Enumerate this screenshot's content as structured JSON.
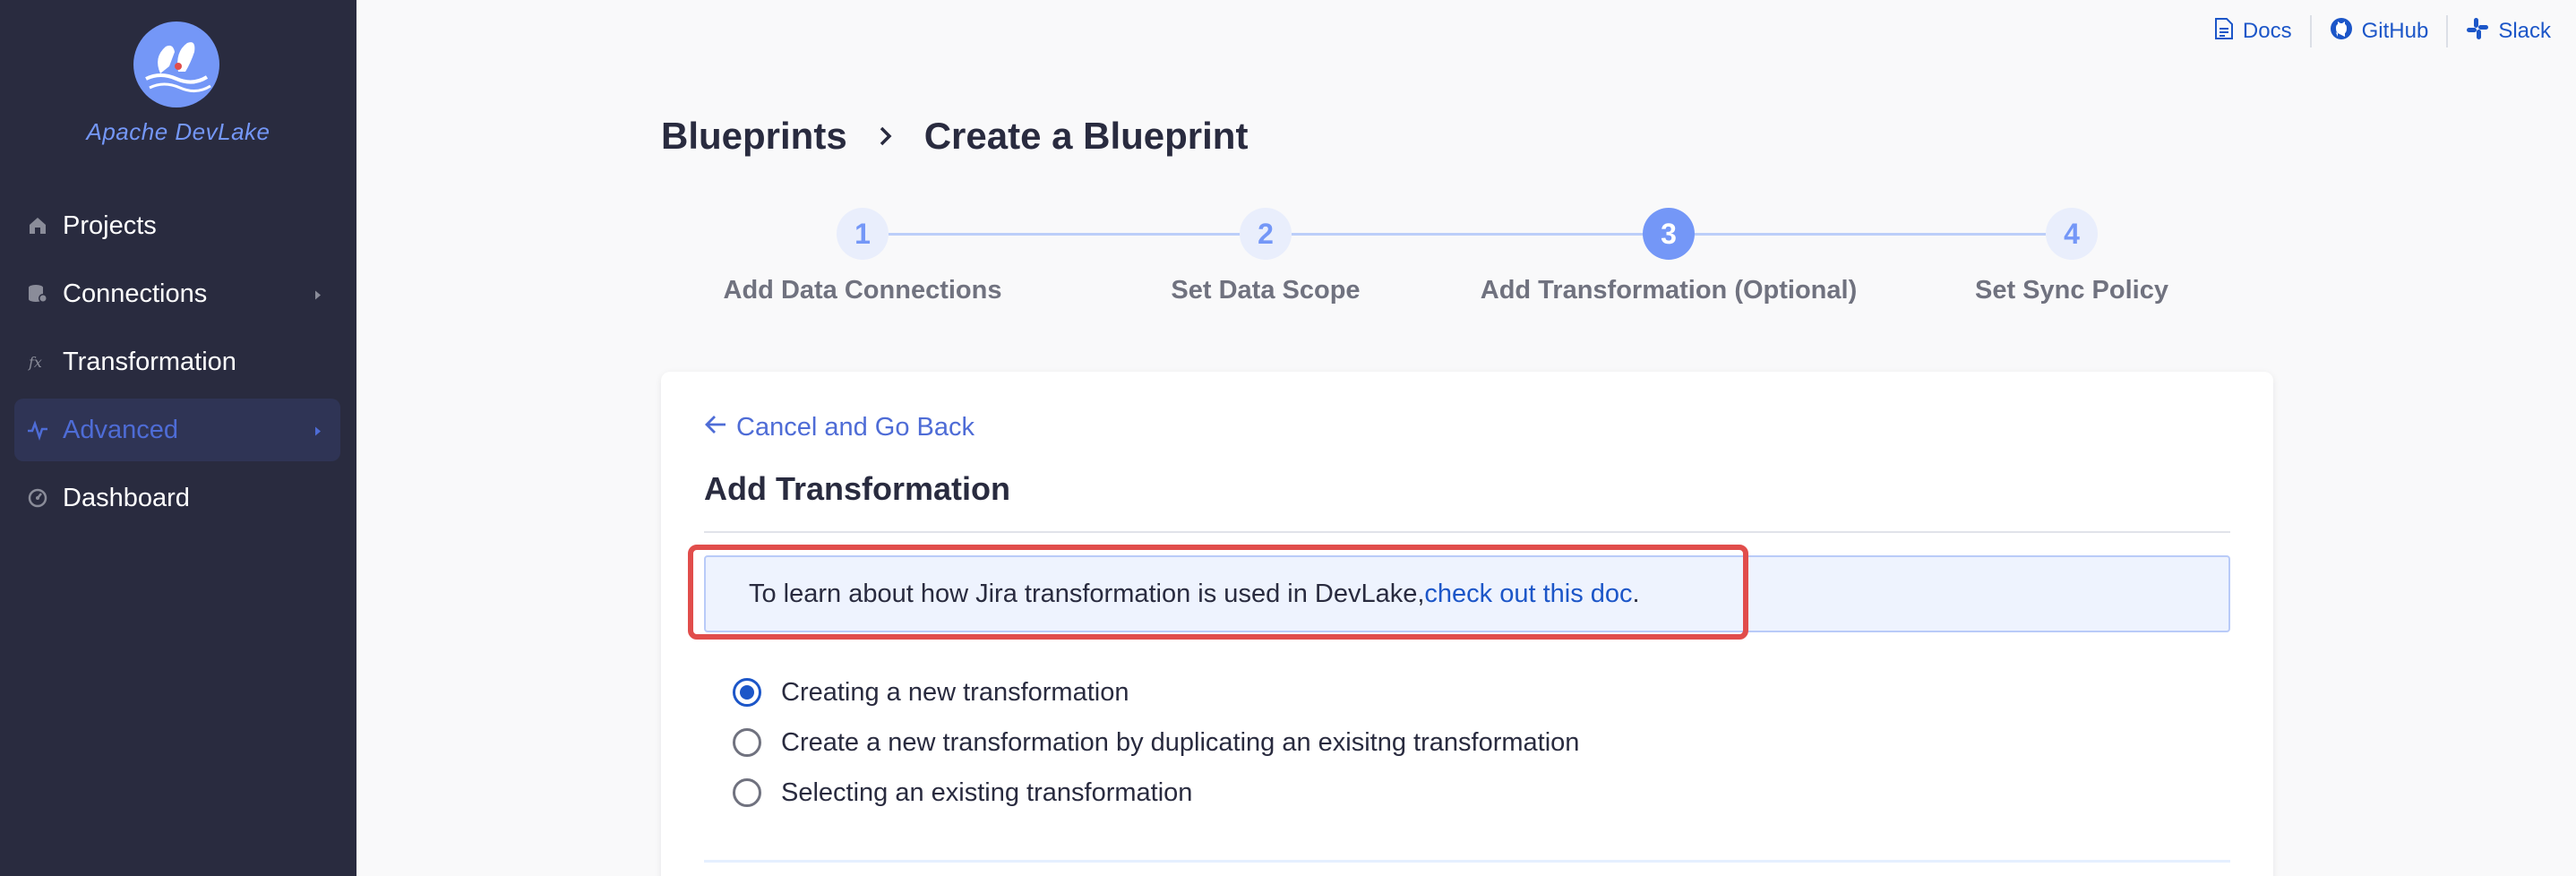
{
  "app": {
    "name": "Apache DevLake"
  },
  "sidebar": {
    "items": [
      {
        "label": "Projects",
        "icon": "home-icon",
        "active": false,
        "has_caret": false
      },
      {
        "label": "Connections",
        "icon": "database-icon",
        "active": false,
        "has_caret": true
      },
      {
        "label": "Transformation",
        "icon": "function-icon",
        "active": false,
        "has_caret": false
      },
      {
        "label": "Advanced",
        "icon": "pulse-icon",
        "active": true,
        "has_caret": true
      },
      {
        "label": "Dashboard",
        "icon": "dashboard-icon",
        "active": false,
        "has_caret": false
      }
    ]
  },
  "toplinks": [
    {
      "label": "Docs",
      "icon": "document-icon"
    },
    {
      "label": "GitHub",
      "icon": "github-icon"
    },
    {
      "label": "Slack",
      "icon": "slack-icon"
    }
  ],
  "breadcrumb": {
    "parent": "Blueprints",
    "current": "Create a Blueprint"
  },
  "stepper": {
    "current": 3,
    "steps": [
      {
        "number": "1",
        "label": "Add Data Connections"
      },
      {
        "number": "2",
        "label": "Set Data Scope"
      },
      {
        "number": "3",
        "label": "Add Transformation (Optional)"
      },
      {
        "number": "4",
        "label": "Set Sync Policy"
      }
    ]
  },
  "card": {
    "back_label": "Cancel and Go Back",
    "title": "Add Transformation",
    "info_text": "To learn about how Jira transformation is used in DevLake, ",
    "info_link": "check out this doc",
    "info_suffix": ".",
    "options": [
      {
        "label": "Creating a new transformation",
        "checked": true
      },
      {
        "label": "Create a new transformation by duplicating an exisitng transformation",
        "checked": false
      },
      {
        "label": "Selecting an existing transformation",
        "checked": false
      }
    ]
  },
  "colors": {
    "sidebar": "#292b3f",
    "accent": "#7497f7",
    "link": "#1c56c8",
    "highlight": "#e14d4b"
  }
}
